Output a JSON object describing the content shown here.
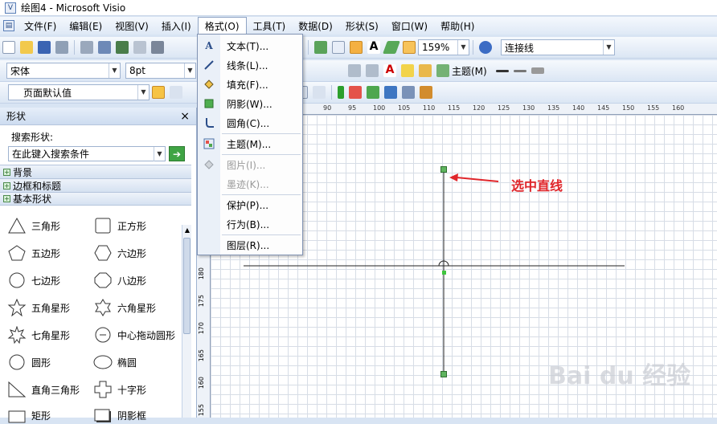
{
  "window": {
    "title": "绘图4 - Microsoft Visio"
  },
  "menubar": {
    "items": [
      "文件(F)",
      "编辑(E)",
      "视图(V)",
      "插入(I)",
      "格式(O)",
      "工具(T)",
      "数据(D)",
      "形状(S)",
      "窗口(W)",
      "帮助(H)"
    ]
  },
  "toolbar": {
    "zoom": "159%",
    "connector_style": "连接线",
    "font_name": "宋体",
    "font_size": "8pt",
    "style_label": "页面默认值",
    "theme_button": "主题(M)"
  },
  "format_menu": {
    "items": [
      {
        "label": "文本(T)...",
        "icon": "text-icon",
        "enabled": true
      },
      {
        "label": "线条(L)...",
        "icon": "pen-icon",
        "enabled": true
      },
      {
        "label": "填充(F)...",
        "icon": "paint-bucket-icon",
        "enabled": true
      },
      {
        "label": "阴影(W)...",
        "icon": "shadow-square-icon",
        "enabled": true
      },
      {
        "label": "圆角(C)...",
        "icon": "round-corner-icon",
        "enabled": true
      },
      {
        "label": "主题(M)...",
        "icon": "theme-icon",
        "enabled": true
      },
      {
        "label": "图片(I)...",
        "icon": "picture-icon",
        "enabled": false
      },
      {
        "label": "墨迹(K)...",
        "icon": "",
        "enabled": false
      },
      {
        "label": "保护(P)...",
        "icon": "",
        "enabled": true
      },
      {
        "label": "行为(B)...",
        "icon": "",
        "enabled": true
      },
      {
        "label": "图层(R)...",
        "icon": "",
        "enabled": true
      }
    ]
  },
  "shapes_panel": {
    "title": "形状",
    "close": "×",
    "search_label": "搜索形状:",
    "search_placeholder": "在此键入搜索条件",
    "groups": [
      "背景",
      "边框和标题",
      "基本形状"
    ],
    "items": [
      "三角形",
      "正方形",
      "五边形",
      "六边形",
      "七边形",
      "八边形",
      "五角星形",
      "六角星形",
      "七角星形",
      "中心拖动圆形",
      "圆形",
      "椭圆",
      "直角三角形",
      "十字形",
      "矩形",
      "阴影框"
    ]
  },
  "rulers": {
    "top_ticks": [
      "90",
      "95",
      "100",
      "105",
      "110",
      "115",
      "120",
      "125",
      "130",
      "135",
      "140",
      "145",
      "150",
      "155",
      "160"
    ],
    "left_ticks": [
      "180",
      "175",
      "170",
      "165",
      "160",
      "155"
    ]
  },
  "annotation": {
    "text": "选中直线",
    "color": "#e0262b"
  },
  "watermark": {
    "text": "Bai du 经验"
  }
}
